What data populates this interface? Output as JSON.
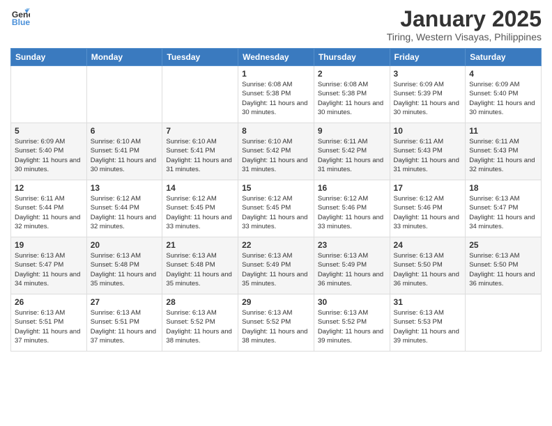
{
  "header": {
    "logo_general": "General",
    "logo_blue": "Blue",
    "month": "January 2025",
    "location": "Tiring, Western Visayas, Philippines"
  },
  "weekdays": [
    "Sunday",
    "Monday",
    "Tuesday",
    "Wednesday",
    "Thursday",
    "Friday",
    "Saturday"
  ],
  "weeks": [
    [
      {
        "day": "",
        "sunrise": "",
        "sunset": "",
        "daylight": ""
      },
      {
        "day": "",
        "sunrise": "",
        "sunset": "",
        "daylight": ""
      },
      {
        "day": "",
        "sunrise": "",
        "sunset": "",
        "daylight": ""
      },
      {
        "day": "1",
        "sunrise": "Sunrise: 6:08 AM",
        "sunset": "Sunset: 5:38 PM",
        "daylight": "Daylight: 11 hours and 30 minutes."
      },
      {
        "day": "2",
        "sunrise": "Sunrise: 6:08 AM",
        "sunset": "Sunset: 5:38 PM",
        "daylight": "Daylight: 11 hours and 30 minutes."
      },
      {
        "day": "3",
        "sunrise": "Sunrise: 6:09 AM",
        "sunset": "Sunset: 5:39 PM",
        "daylight": "Daylight: 11 hours and 30 minutes."
      },
      {
        "day": "4",
        "sunrise": "Sunrise: 6:09 AM",
        "sunset": "Sunset: 5:40 PM",
        "daylight": "Daylight: 11 hours and 30 minutes."
      }
    ],
    [
      {
        "day": "5",
        "sunrise": "Sunrise: 6:09 AM",
        "sunset": "Sunset: 5:40 PM",
        "daylight": "Daylight: 11 hours and 30 minutes."
      },
      {
        "day": "6",
        "sunrise": "Sunrise: 6:10 AM",
        "sunset": "Sunset: 5:41 PM",
        "daylight": "Daylight: 11 hours and 30 minutes."
      },
      {
        "day": "7",
        "sunrise": "Sunrise: 6:10 AM",
        "sunset": "Sunset: 5:41 PM",
        "daylight": "Daylight: 11 hours and 31 minutes."
      },
      {
        "day": "8",
        "sunrise": "Sunrise: 6:10 AM",
        "sunset": "Sunset: 5:42 PM",
        "daylight": "Daylight: 11 hours and 31 minutes."
      },
      {
        "day": "9",
        "sunrise": "Sunrise: 6:11 AM",
        "sunset": "Sunset: 5:42 PM",
        "daylight": "Daylight: 11 hours and 31 minutes."
      },
      {
        "day": "10",
        "sunrise": "Sunrise: 6:11 AM",
        "sunset": "Sunset: 5:43 PM",
        "daylight": "Daylight: 11 hours and 31 minutes."
      },
      {
        "day": "11",
        "sunrise": "Sunrise: 6:11 AM",
        "sunset": "Sunset: 5:43 PM",
        "daylight": "Daylight: 11 hours and 32 minutes."
      }
    ],
    [
      {
        "day": "12",
        "sunrise": "Sunrise: 6:11 AM",
        "sunset": "Sunset: 5:44 PM",
        "daylight": "Daylight: 11 hours and 32 minutes."
      },
      {
        "day": "13",
        "sunrise": "Sunrise: 6:12 AM",
        "sunset": "Sunset: 5:44 PM",
        "daylight": "Daylight: 11 hours and 32 minutes."
      },
      {
        "day": "14",
        "sunrise": "Sunrise: 6:12 AM",
        "sunset": "Sunset: 5:45 PM",
        "daylight": "Daylight: 11 hours and 33 minutes."
      },
      {
        "day": "15",
        "sunrise": "Sunrise: 6:12 AM",
        "sunset": "Sunset: 5:45 PM",
        "daylight": "Daylight: 11 hours and 33 minutes."
      },
      {
        "day": "16",
        "sunrise": "Sunrise: 6:12 AM",
        "sunset": "Sunset: 5:46 PM",
        "daylight": "Daylight: 11 hours and 33 minutes."
      },
      {
        "day": "17",
        "sunrise": "Sunrise: 6:12 AM",
        "sunset": "Sunset: 5:46 PM",
        "daylight": "Daylight: 11 hours and 33 minutes."
      },
      {
        "day": "18",
        "sunrise": "Sunrise: 6:13 AM",
        "sunset": "Sunset: 5:47 PM",
        "daylight": "Daylight: 11 hours and 34 minutes."
      }
    ],
    [
      {
        "day": "19",
        "sunrise": "Sunrise: 6:13 AM",
        "sunset": "Sunset: 5:47 PM",
        "daylight": "Daylight: 11 hours and 34 minutes."
      },
      {
        "day": "20",
        "sunrise": "Sunrise: 6:13 AM",
        "sunset": "Sunset: 5:48 PM",
        "daylight": "Daylight: 11 hours and 35 minutes."
      },
      {
        "day": "21",
        "sunrise": "Sunrise: 6:13 AM",
        "sunset": "Sunset: 5:48 PM",
        "daylight": "Daylight: 11 hours and 35 minutes."
      },
      {
        "day": "22",
        "sunrise": "Sunrise: 6:13 AM",
        "sunset": "Sunset: 5:49 PM",
        "daylight": "Daylight: 11 hours and 35 minutes."
      },
      {
        "day": "23",
        "sunrise": "Sunrise: 6:13 AM",
        "sunset": "Sunset: 5:49 PM",
        "daylight": "Daylight: 11 hours and 36 minutes."
      },
      {
        "day": "24",
        "sunrise": "Sunrise: 6:13 AM",
        "sunset": "Sunset: 5:50 PM",
        "daylight": "Daylight: 11 hours and 36 minutes."
      },
      {
        "day": "25",
        "sunrise": "Sunrise: 6:13 AM",
        "sunset": "Sunset: 5:50 PM",
        "daylight": "Daylight: 11 hours and 36 minutes."
      }
    ],
    [
      {
        "day": "26",
        "sunrise": "Sunrise: 6:13 AM",
        "sunset": "Sunset: 5:51 PM",
        "daylight": "Daylight: 11 hours and 37 minutes."
      },
      {
        "day": "27",
        "sunrise": "Sunrise: 6:13 AM",
        "sunset": "Sunset: 5:51 PM",
        "daylight": "Daylight: 11 hours and 37 minutes."
      },
      {
        "day": "28",
        "sunrise": "Sunrise: 6:13 AM",
        "sunset": "Sunset: 5:52 PM",
        "daylight": "Daylight: 11 hours and 38 minutes."
      },
      {
        "day": "29",
        "sunrise": "Sunrise: 6:13 AM",
        "sunset": "Sunset: 5:52 PM",
        "daylight": "Daylight: 11 hours and 38 minutes."
      },
      {
        "day": "30",
        "sunrise": "Sunrise: 6:13 AM",
        "sunset": "Sunset: 5:52 PM",
        "daylight": "Daylight: 11 hours and 39 minutes."
      },
      {
        "day": "31",
        "sunrise": "Sunrise: 6:13 AM",
        "sunset": "Sunset: 5:53 PM",
        "daylight": "Daylight: 11 hours and 39 minutes."
      },
      {
        "day": "",
        "sunrise": "",
        "sunset": "",
        "daylight": ""
      }
    ]
  ]
}
